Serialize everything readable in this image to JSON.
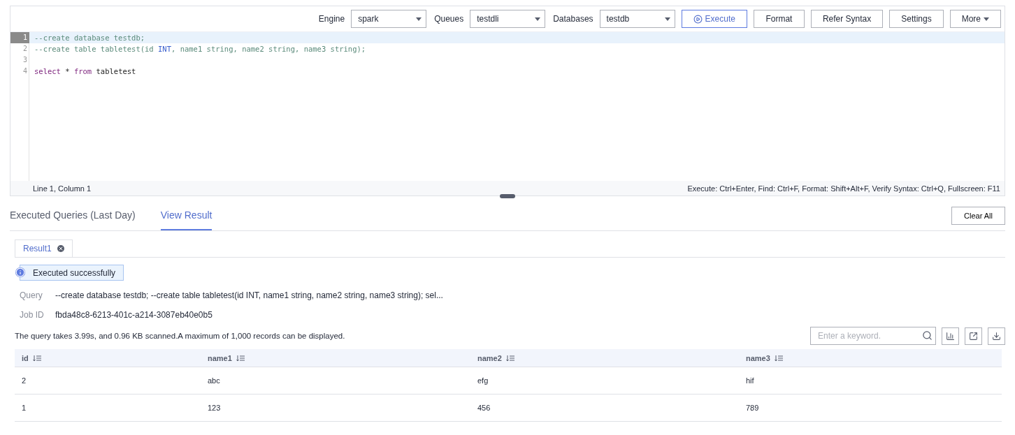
{
  "toolbar": {
    "selects": [
      {
        "label": "Engine",
        "value": "spark"
      },
      {
        "label": "Queues",
        "value": "testdli"
      },
      {
        "label": "Databases",
        "value": "testdb"
      }
    ],
    "buttons": [
      {
        "label": "Execute",
        "kind": "primary"
      },
      {
        "label": "Format",
        "kind": "plain"
      },
      {
        "label": "Refer Syntax",
        "kind": "plain"
      },
      {
        "label": "Settings",
        "kind": "plain"
      },
      {
        "label": "More",
        "kind": "menu"
      }
    ]
  },
  "editor": {
    "lines": [
      {
        "number": "1",
        "active": true,
        "tokens": [
          {
            "text": "--create database testdb;",
            "kind": "comment"
          }
        ]
      },
      {
        "number": "2",
        "active": false,
        "tokens": [
          {
            "text": "--create table tabletest(id ",
            "kind": "comment"
          },
          {
            "text": "INT",
            "kind": "type"
          },
          {
            "text": ", name1 string, name2 string, name3 string);",
            "kind": "comment"
          }
        ]
      },
      {
        "number": "3",
        "active": false
      },
      {
        "number": "4",
        "active": false,
        "tokens": [
          {
            "text": "select",
            "kind": "keyword"
          },
          {
            "text": " * ",
            "kind": "plain"
          },
          {
            "text": "from",
            "kind": "keyword"
          },
          {
            "text": " tabletest",
            "kind": "plain"
          }
        ]
      }
    ],
    "status_left": "Line 1, Column 1",
    "status_right": "Execute: Ctrl+Enter, Find: Ctrl+F, Format: Shift+Alt+F, Verify Syntax: Ctrl+Q, Fullscreen: F11"
  },
  "tabs": [
    {
      "label": "Executed Queries (Last Day)",
      "selected": false
    },
    {
      "label": "View Result",
      "selected": true
    }
  ],
  "clear_all": "Clear All",
  "result_tabs": [
    {
      "label": "Result1",
      "selected": true
    }
  ],
  "message": "Executed successfully",
  "details": [
    {
      "label": "Query",
      "value": "--create database testdb; --create table tabletest(id INT, name1 string, name2 string, name3 string); sel..."
    },
    {
      "label": "Job ID",
      "value": "fbda48c8-6213-401c-a214-3087eb40e0b5"
    }
  ],
  "summary": "The query takes 3.99s, and 0.96 KB scanned.A maximum of 1,000 records can be displayed.",
  "search": {
    "placeholder": "Enter a keyword."
  },
  "table": {
    "columns": [
      "id",
      "name1",
      "name2",
      "name3"
    ],
    "rows": [
      [
        "2",
        "abc",
        "efg",
        "hif"
      ],
      [
        "1",
        "123",
        "456",
        "789"
      ]
    ]
  }
}
